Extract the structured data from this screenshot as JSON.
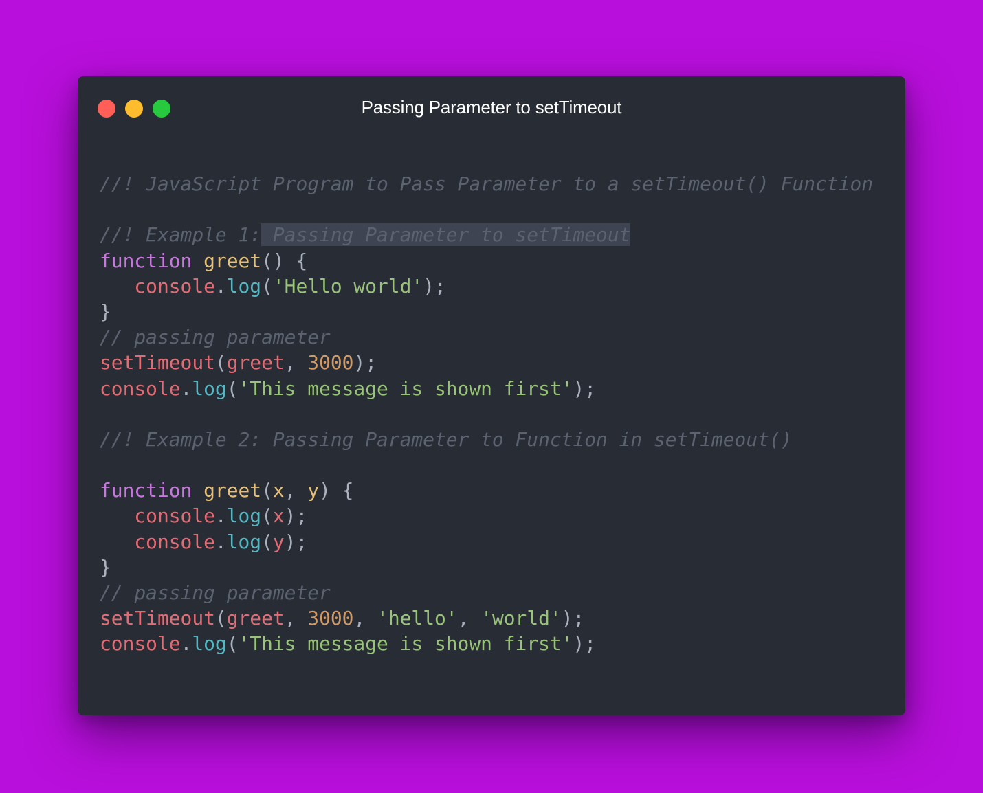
{
  "window": {
    "title": "Passing Parameter to setTimeout",
    "buttons": [
      {
        "name": "close",
        "color": "#ff5f56"
      },
      {
        "name": "minimize",
        "color": "#ffbd2e"
      },
      {
        "name": "maximize",
        "color": "#27c93f"
      }
    ]
  },
  "colors": {
    "background": "#b90fdc",
    "editor": "#282c34"
  },
  "code": {
    "header_comment": "//! JavaScript Program to Pass Parameter to a setTimeout() Function",
    "ex1_comment_prefix": "//! Example 1:",
    "ex1_comment_selected": " Passing Parameter to setTimeout",
    "ex1_keyword": "function",
    "ex1_fn_name": "greet",
    "ex1_sig_rest": "() {",
    "ex1_console": "console",
    "ex1_log": "log",
    "ex1_string": "'Hello world'",
    "ex1_close": "}",
    "ex1_pass_comment": "// passing parameter",
    "ex1_settimeout": "setTimeout",
    "ex1_arg_greet": "greet",
    "ex1_delay": "3000",
    "ex1_console2": "console",
    "ex1_log2": "log",
    "ex1_msg": "'This message is shown first'",
    "ex2_comment": "//! Example 2: Passing Parameter to Function in setTimeout()",
    "ex2_keyword": "function",
    "ex2_fn_name": "greet",
    "ex2_param_x": "x",
    "ex2_param_y": "y",
    "ex2_console_a": "console",
    "ex2_log_a": "log",
    "ex2_arg_x": "x",
    "ex2_console_b": "console",
    "ex2_log_b": "log",
    "ex2_arg_y": "y",
    "ex2_close": "}",
    "ex2_pass_comment": "// passing parameter",
    "ex2_settimeout": "setTimeout",
    "ex2_arg_greet": "greet",
    "ex2_delay": "3000",
    "ex2_hello": "'hello'",
    "ex2_world": "'world'",
    "ex2_console2": "console",
    "ex2_log2": "log",
    "ex2_msg": "'This message is shown first'"
  }
}
